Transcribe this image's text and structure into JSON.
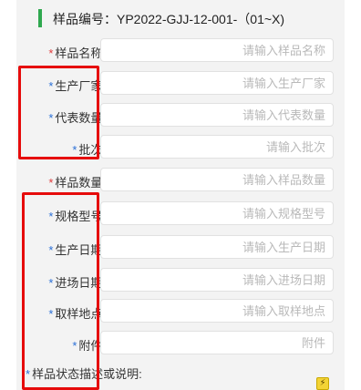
{
  "header": {
    "title": "样品编号：YP2022-GJJ-12-001-（01~X)"
  },
  "form": {
    "fields": [
      {
        "required_mark": "*",
        "label": "样品名称:",
        "placeholder": "请输入样品名称"
      },
      {
        "required_mark": "*",
        "label": "生产厂家:",
        "placeholder": "请输入生产厂家"
      },
      {
        "required_mark": "*",
        "label": "代表数量:",
        "placeholder": "请输入代表数量"
      },
      {
        "required_mark": "*",
        "label": "批次:",
        "placeholder": "请输入批次"
      },
      {
        "required_mark": "*",
        "label": "样品数量:",
        "placeholder": "请输入样品数量"
      },
      {
        "required_mark": "*",
        "label": "规格型号:",
        "placeholder": "请输入规格型号"
      },
      {
        "required_mark": "*",
        "label": "生产日期:",
        "placeholder": "请输入生产日期"
      },
      {
        "required_mark": "*",
        "label": "进场日期:",
        "placeholder": "请输入进场日期"
      },
      {
        "required_mark": "*",
        "label": "取样地点:",
        "placeholder": "请输入取样地点"
      },
      {
        "required_mark": "*",
        "label": "附件:",
        "placeholder": "附件"
      }
    ],
    "status": {
      "required_mark": "*",
      "label": "样品状态描述或说明:"
    }
  },
  "colors": {
    "accent_green": "#2fa84f",
    "required_red": "#e03b3b",
    "required_blue": "#2a6fd6",
    "highlight_red": "#e60b0b"
  },
  "icons": {
    "status_action": "flash-icon"
  }
}
